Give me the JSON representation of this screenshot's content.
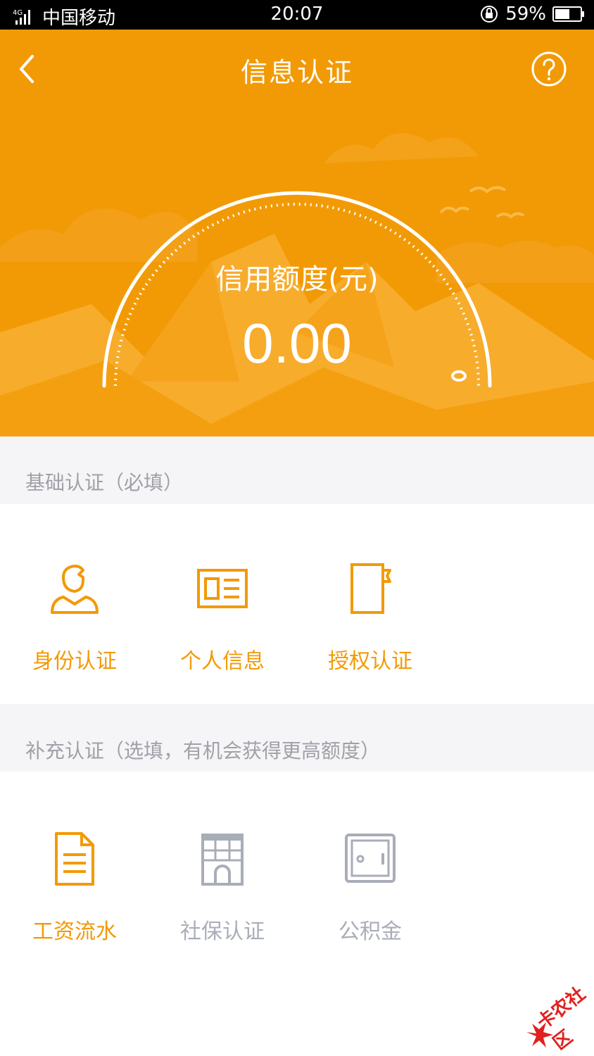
{
  "status_bar": {
    "network": "4G",
    "carrier": "中国移动",
    "time": "20:07",
    "battery": "59%"
  },
  "header": {
    "title": "信息认证",
    "back_icon": "chevron-left-icon",
    "help_icon": "question-circle-icon"
  },
  "credit": {
    "label": "信用额度(元)",
    "value": "0.00",
    "progress": 0
  },
  "basic_section": {
    "title": "基础认证（必填）",
    "items": [
      {
        "label": "身份认证",
        "icon": "user-icon",
        "state": "active"
      },
      {
        "label": "个人信息",
        "icon": "id-card-icon",
        "state": "active"
      },
      {
        "label": "授权认证",
        "icon": "notebook-icon",
        "state": "active"
      }
    ]
  },
  "extra_section": {
    "title": "补充认证（选填，有机会获得更高额度）",
    "items": [
      {
        "label": "工资流水",
        "icon": "document-icon",
        "state": "active"
      },
      {
        "label": "社保认证",
        "icon": "building-icon",
        "state": "inactive"
      },
      {
        "label": "公积金",
        "icon": "safe-icon",
        "state": "inactive"
      }
    ]
  },
  "watermark": {
    "text": "卡农社区"
  },
  "colors": {
    "primary": "#f29a05",
    "inactive": "#a9adb8",
    "section_bg": "#f5f5f7"
  }
}
